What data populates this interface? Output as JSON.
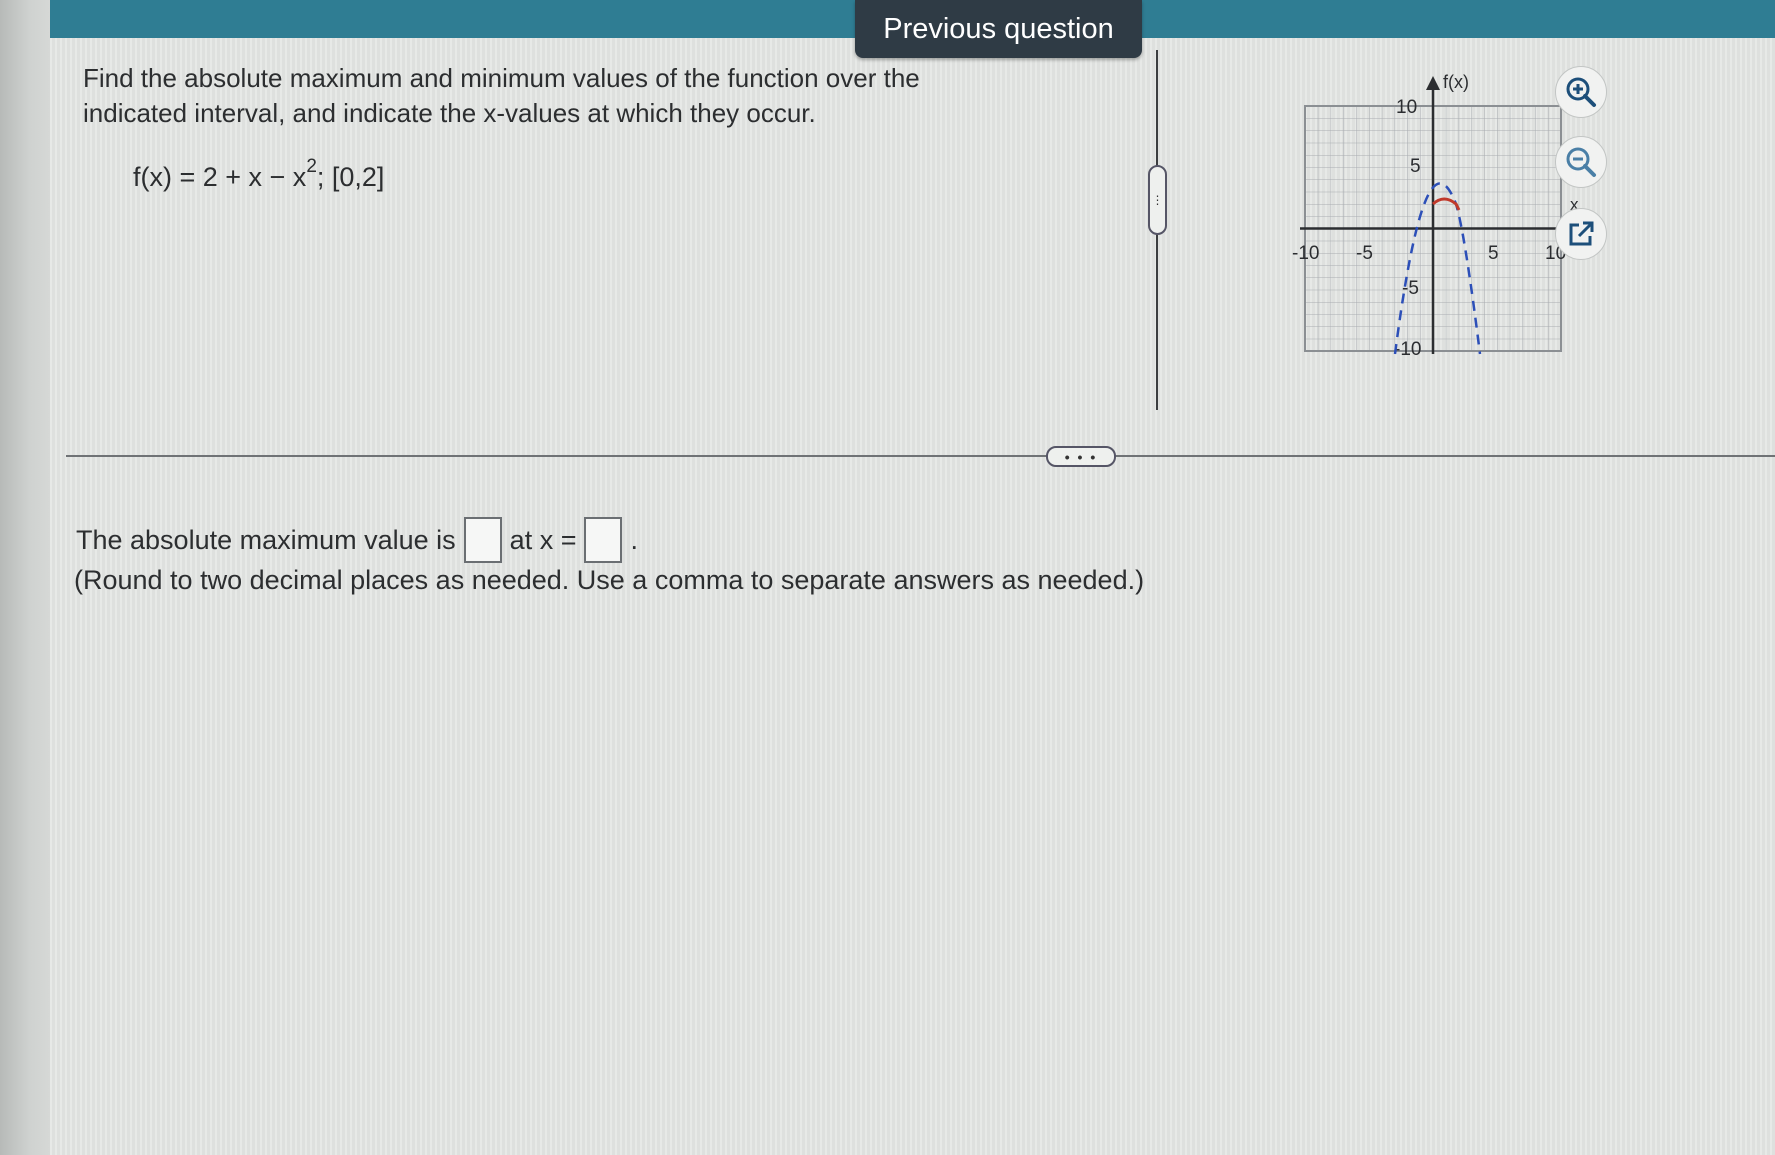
{
  "header": {
    "previous_question_label": "Previous question"
  },
  "question": {
    "prompt": "Find the absolute maximum and minimum values of the function over the indicated interval, and indicate the x-values at which they occur.",
    "formula_prefix": "f(x) = 2 + x − x",
    "formula_exponent": "2",
    "formula_suffix": "; [0,2]"
  },
  "graph": {
    "y_axis_label": "f(x)",
    "x_axis_label": "x",
    "x_tick_labels": [
      "-10",
      "-5",
      "5",
      "10"
    ],
    "y_tick_labels": [
      "10",
      "5",
      "-5",
      "-10"
    ],
    "curve_color": "#c0392b",
    "dashed_color": "#2c4fb8"
  },
  "tools": {
    "zoom_in_icon": "zoom-in-icon",
    "zoom_out_icon": "zoom-out-icon",
    "open_new_icon": "external-link-icon"
  },
  "answer": {
    "max_label": "The absolute maximum value is",
    "at_label": "at x =",
    "end_punct": ".",
    "note": "(Round to two decimal places as needed. Use a comma to separate answers as needed.)"
  },
  "handles": {
    "vertical_dots": "⋮",
    "horizontal_dots": "• • •"
  }
}
